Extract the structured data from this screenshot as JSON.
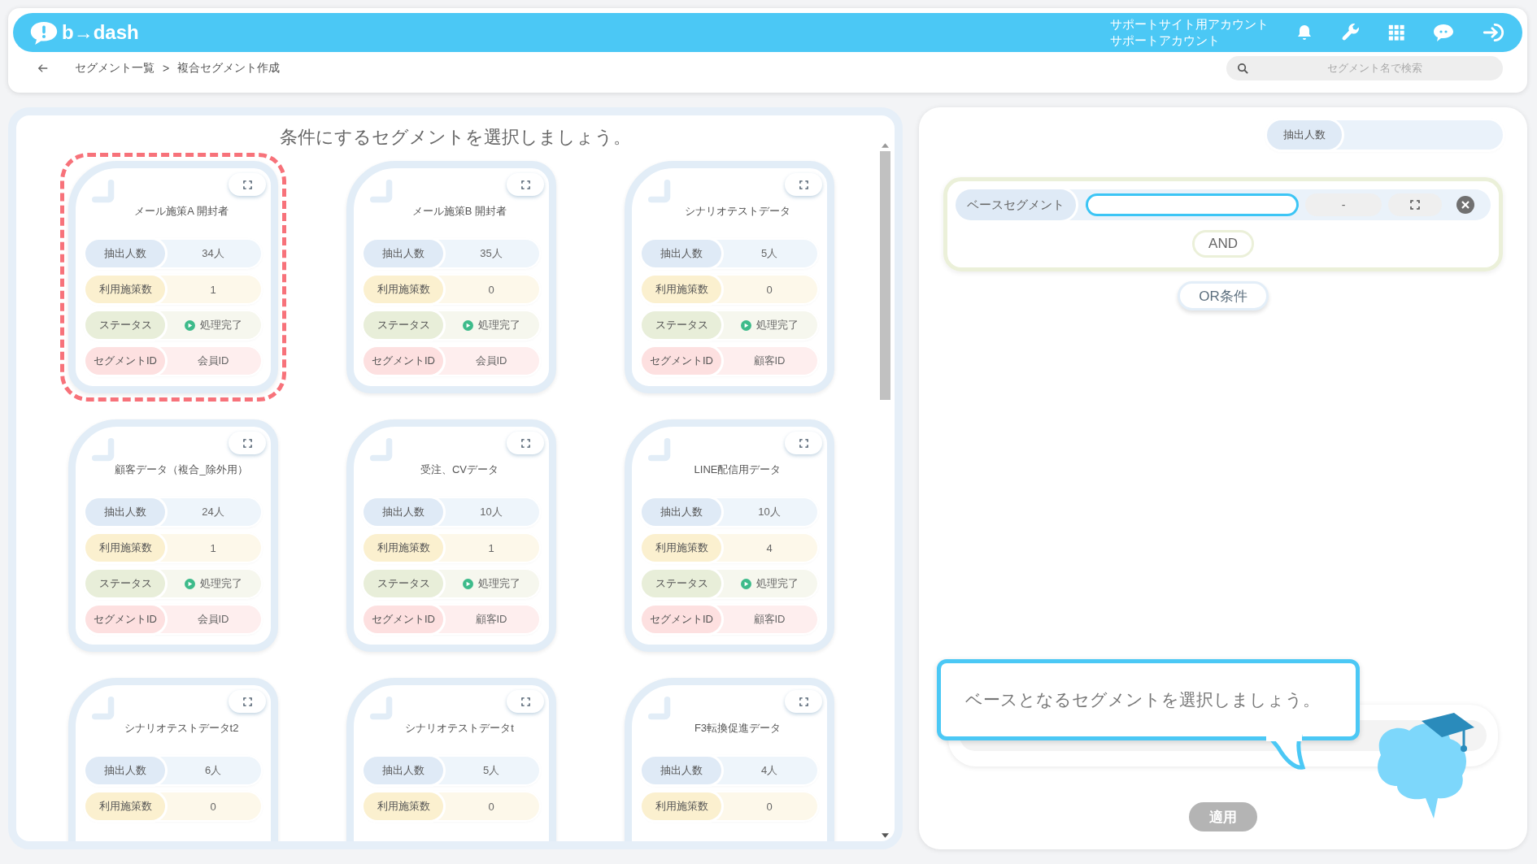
{
  "header": {
    "logo": "b→dash",
    "account_lines": [
      "サポートサイト用アカウント",
      "サポートアカウント"
    ]
  },
  "breadcrumb": {
    "items": [
      "セグメント一覧",
      "複合セグメント作成"
    ],
    "separator": ">"
  },
  "search": {
    "placeholder": "セグメント名で検索"
  },
  "segment_list": {
    "title": "条件にするセグメントを選択しましょう。",
    "cards": [
      {
        "name": "メール施策A 開封者",
        "selected": true,
        "stats": [
          {
            "kind": "count",
            "label": "抽出人数",
            "value": "34人"
          },
          {
            "kind": "usage",
            "label": "利用施策数",
            "value": "1"
          },
          {
            "kind": "status",
            "label": "ステータス",
            "value": "処理完了"
          },
          {
            "kind": "segment_id",
            "label": "セグメントID",
            "value": "会員ID"
          }
        ]
      },
      {
        "name": "メール施策B 開封者",
        "selected": false,
        "stats": [
          {
            "kind": "count",
            "label": "抽出人数",
            "value": "35人"
          },
          {
            "kind": "usage",
            "label": "利用施策数",
            "value": "0"
          },
          {
            "kind": "status",
            "label": "ステータス",
            "value": "処理完了"
          },
          {
            "kind": "segment_id",
            "label": "セグメントID",
            "value": "会員ID"
          }
        ]
      },
      {
        "name": "シナリオテストデータ",
        "selected": false,
        "stats": [
          {
            "kind": "count",
            "label": "抽出人数",
            "value": "5人"
          },
          {
            "kind": "usage",
            "label": "利用施策数",
            "value": "0"
          },
          {
            "kind": "status",
            "label": "ステータス",
            "value": "処理完了"
          },
          {
            "kind": "segment_id",
            "label": "セグメントID",
            "value": "顧客ID"
          }
        ]
      },
      {
        "name": "顧客データ（複合_除外用）",
        "selected": false,
        "stats": [
          {
            "kind": "count",
            "label": "抽出人数",
            "value": "24人"
          },
          {
            "kind": "usage",
            "label": "利用施策数",
            "value": "1"
          },
          {
            "kind": "status",
            "label": "ステータス",
            "value": "処理完了"
          },
          {
            "kind": "segment_id",
            "label": "セグメントID",
            "value": "会員ID"
          }
        ]
      },
      {
        "name": "受注、CVデータ",
        "selected": false,
        "stats": [
          {
            "kind": "count",
            "label": "抽出人数",
            "value": "10人"
          },
          {
            "kind": "usage",
            "label": "利用施策数",
            "value": "1"
          },
          {
            "kind": "status",
            "label": "ステータス",
            "value": "処理完了"
          },
          {
            "kind": "segment_id",
            "label": "セグメントID",
            "value": "顧客ID"
          }
        ]
      },
      {
        "name": "LINE配信用データ",
        "selected": false,
        "stats": [
          {
            "kind": "count",
            "label": "抽出人数",
            "value": "10人"
          },
          {
            "kind": "usage",
            "label": "利用施策数",
            "value": "4"
          },
          {
            "kind": "status",
            "label": "ステータス",
            "value": "処理完了"
          },
          {
            "kind": "segment_id",
            "label": "セグメントID",
            "value": "顧客ID"
          }
        ]
      },
      {
        "name": "シナリオテストデータt2",
        "selected": false,
        "stats": [
          {
            "kind": "count",
            "label": "抽出人数",
            "value": "6人"
          },
          {
            "kind": "usage",
            "label": "利用施策数",
            "value": "0"
          }
        ]
      },
      {
        "name": "シナリオテストデータt",
        "selected": false,
        "stats": [
          {
            "kind": "count",
            "label": "抽出人数",
            "value": "5人"
          },
          {
            "kind": "usage",
            "label": "利用施策数",
            "value": "0"
          }
        ]
      },
      {
        "name": "F3転換促進データ",
        "selected": false,
        "stats": [
          {
            "kind": "count",
            "label": "抽出人数",
            "value": "4人"
          },
          {
            "kind": "usage",
            "label": "利用施策数",
            "value": "0"
          }
        ]
      }
    ]
  },
  "builder": {
    "count_label": "抽出人数",
    "base": {
      "label": "ベースセグメント",
      "focused": true,
      "count": "-"
    },
    "and_button": "AND",
    "or_button": "OR条件",
    "hint": "ベースとなるセグメントを選択しましょう。",
    "apply_button": {
      "label": "適用",
      "disabled": true
    }
  }
}
